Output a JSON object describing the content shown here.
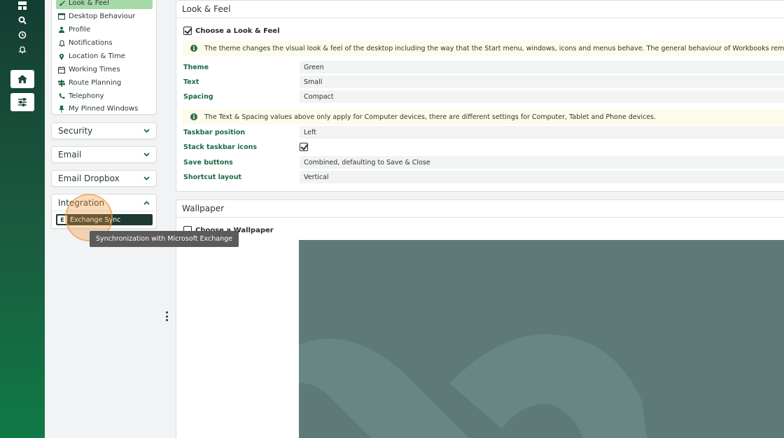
{
  "taskbar": {
    "icons": [
      "grid-icon",
      "search-icon",
      "clock-icon",
      "bell-icon"
    ],
    "buttons": [
      "home-icon",
      "sliders-icon"
    ]
  },
  "left_menu": {
    "items": [
      {
        "label": "Look & Feel",
        "icon": "paintbrush-icon",
        "active": true
      },
      {
        "label": "Desktop Behaviour",
        "icon": "window-icon"
      },
      {
        "label": "Profile",
        "icon": "person-icon"
      },
      {
        "label": "Notifications",
        "icon": "bell-icon"
      },
      {
        "label": "Location & Time",
        "icon": "pin-icon"
      },
      {
        "label": "Working Times",
        "icon": "calendar-icon"
      },
      {
        "label": "Route Planning",
        "icon": "signpost-icon"
      },
      {
        "label": "Telephony",
        "icon": "phone-icon"
      },
      {
        "label": "My Pinned Windows",
        "icon": "pushpin-icon"
      }
    ],
    "sections": {
      "security": "Security",
      "email": "Email",
      "email_dropbox": "Email Dropbox",
      "integration": "Integration"
    },
    "integration_item": "Exchange Sync",
    "integration_icon_letter": "E"
  },
  "tooltip": "Synchronization with Microsoft Exchange",
  "look_feel": {
    "title": "Look & Feel",
    "choose_label": "Choose a Look & Feel",
    "info1": "The theme changes the visual look & feel of the desktop including the way that the Start menu, windows, icons and menus behave. The general behaviour of Workbooks remains the same.",
    "theme": {
      "label": "Theme",
      "value": "Green"
    },
    "text": {
      "label": "Text",
      "value": "Small"
    },
    "spacing": {
      "label": "Spacing",
      "value": "Compact"
    },
    "info2": "The Text & Spacing values above only apply for Computer devices, there are different settings for Computer, Tablet and Phone devices.",
    "taskbar_position": {
      "label": "Taskbar position",
      "value": "Left"
    },
    "stack_icons": {
      "label": "Stack taskbar icons",
      "checked": true
    },
    "save_buttons": {
      "label": "Save buttons",
      "value": "Combined, defaulting to Save & Close"
    },
    "shortcut_layout": {
      "label": "Shortcut layout",
      "value": "Vertical"
    }
  },
  "wallpaper": {
    "title": "Wallpaper",
    "choose_label": "Choose a Wallpaper",
    "color": "#5e7a77"
  },
  "colors": {
    "accent_green": "#1d6a45",
    "active_menu": "#a8d9a8",
    "highlight": "#f0963c"
  }
}
